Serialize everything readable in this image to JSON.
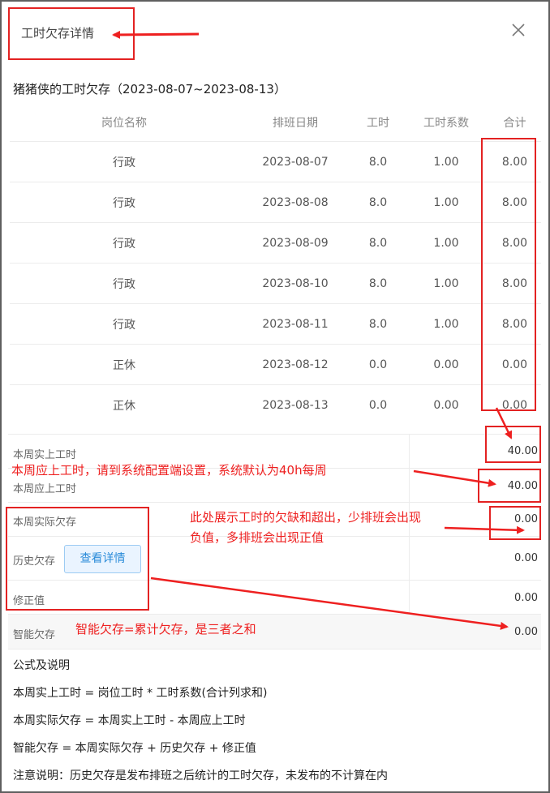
{
  "dialog": {
    "title": "工时欠存详情",
    "subtitle": "猪猪侠的工时欠存（2023-08-07~2023-08-13）"
  },
  "table": {
    "headers": [
      "岗位名称",
      "排班日期",
      "工时",
      "工时系数",
      "合计"
    ],
    "rows": [
      [
        "行政",
        "2023-08-07",
        "8.0",
        "1.00",
        "8.00"
      ],
      [
        "行政",
        "2023-08-08",
        "8.0",
        "1.00",
        "8.00"
      ],
      [
        "行政",
        "2023-08-09",
        "8.0",
        "1.00",
        "8.00"
      ],
      [
        "行政",
        "2023-08-10",
        "8.0",
        "1.00",
        "8.00"
      ],
      [
        "行政",
        "2023-08-11",
        "8.0",
        "1.00",
        "8.00"
      ],
      [
        "正休",
        "2023-08-12",
        "0.0",
        "0.00",
        "0.00"
      ],
      [
        "正休",
        "2023-08-13",
        "0.0",
        "0.00",
        "0.00"
      ]
    ]
  },
  "summary": {
    "actual_hours": {
      "label": "本周实上工时",
      "value": "40.00"
    },
    "required_hours": {
      "label": "本周应上工时",
      "value": "40.00"
    },
    "weekly_balance": {
      "label": "本周实际欠存",
      "value": "0.00"
    },
    "history_balance": {
      "label": "历史欠存",
      "value": "0.00",
      "button": "查看详情"
    },
    "correction": {
      "label": "修正值",
      "value": "0.00"
    },
    "smart_balance": {
      "label": "智能欠存",
      "value": "0.00"
    }
  },
  "notes": {
    "heading": "公式及说明",
    "line1": "本周实上工时 = 岗位工时 * 工时系数(合计列求和)",
    "line2": "本周实际欠存 = 本周实上工时 - 本周应上工时",
    "line3": "智能欠存 = 本周实际欠存 + 历史欠存 + 修正值",
    "line4": "注意说明：历史欠存是发布排班之后统计的工时欠存，未发布的不计算在内"
  },
  "annotations": {
    "required_hours_note": "本周应上工时，请到系统配置端设置，系统默认为40h每周",
    "balance_note_1": "此处展示工时的欠缺和超出，少排班会出现",
    "balance_note_2": "负值，多排班会出现正值",
    "smart_note": "智能欠存=累计欠存，是三者之和"
  },
  "colors": {
    "annotation": "#ee2020",
    "button_text": "#2a8bd9",
    "button_bg": "#eaf4ff"
  },
  "icons": {
    "close": "close-icon"
  }
}
